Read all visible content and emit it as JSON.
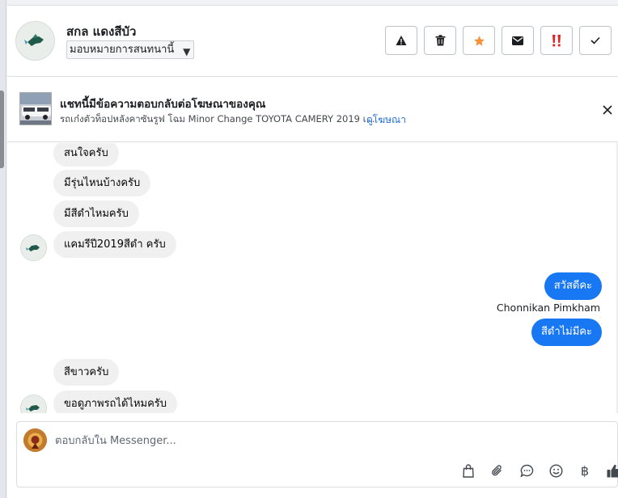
{
  "header": {
    "contact_name": "สกล แดงสีบัว",
    "assign_label": "มอบหมายการสนทนานี้",
    "actions": [
      {
        "name": "report-button",
        "icon": "warning-icon",
        "color": "#1c1e21"
      },
      {
        "name": "delete-button",
        "icon": "trash-icon",
        "color": "#1c1e21"
      },
      {
        "name": "star-button",
        "icon": "star-icon",
        "color": "#f7923b"
      },
      {
        "name": "mark-unread-button",
        "icon": "envelope-icon",
        "color": "#1c1e21"
      },
      {
        "name": "spam-button",
        "icon": "exclamation-icon",
        "color": "#e02424"
      },
      {
        "name": "mark-done-button",
        "icon": "check-icon",
        "color": "#1c1e21"
      }
    ]
  },
  "ad": {
    "title": "แชทนี้มีข้อความตอบกลับต่อโฆษณาของคุณ",
    "subtitle": "รถเก๋งตัวท็อปหลังคาซันรูฟ โฉม Minor Change TOYOTA CAMERY 2019 เ...",
    "link": "ดูโฆษณา",
    "close_icon": "close-icon"
  },
  "messages": [
    {
      "direction": "in",
      "text": "สนใจครับ"
    },
    {
      "direction": "in",
      "text": "มีรุ่นไหนบ้างครับ"
    },
    {
      "direction": "in",
      "text": "มีสีดำไหมครับ"
    },
    {
      "direction": "in",
      "text": "แคมรีปี2019สีดำ ครับ"
    },
    {
      "direction": "out",
      "text": "สวัสดีคะ"
    },
    {
      "direction": "out",
      "sender": "Chonnikan Pimkham",
      "text": "สีดำไม่มีคะ"
    },
    {
      "direction": "in",
      "text": "สีขาวครับ"
    },
    {
      "direction": "in",
      "text": "ขอดูภาพรถได้ไหมครับ"
    }
  ],
  "composer": {
    "placeholder": "ตอบกลับใน Messenger...",
    "tools": [
      "shopping-bag-icon",
      "paperclip-icon",
      "chat-bubble-icon",
      "smiley-icon",
      "baht-icon",
      "thumbs-up-icon"
    ],
    "baht_symbol": "฿"
  },
  "colors": {
    "accent": "#1877f2",
    "incoming_bubble": "#f0f0f0",
    "link": "#216fdb"
  }
}
